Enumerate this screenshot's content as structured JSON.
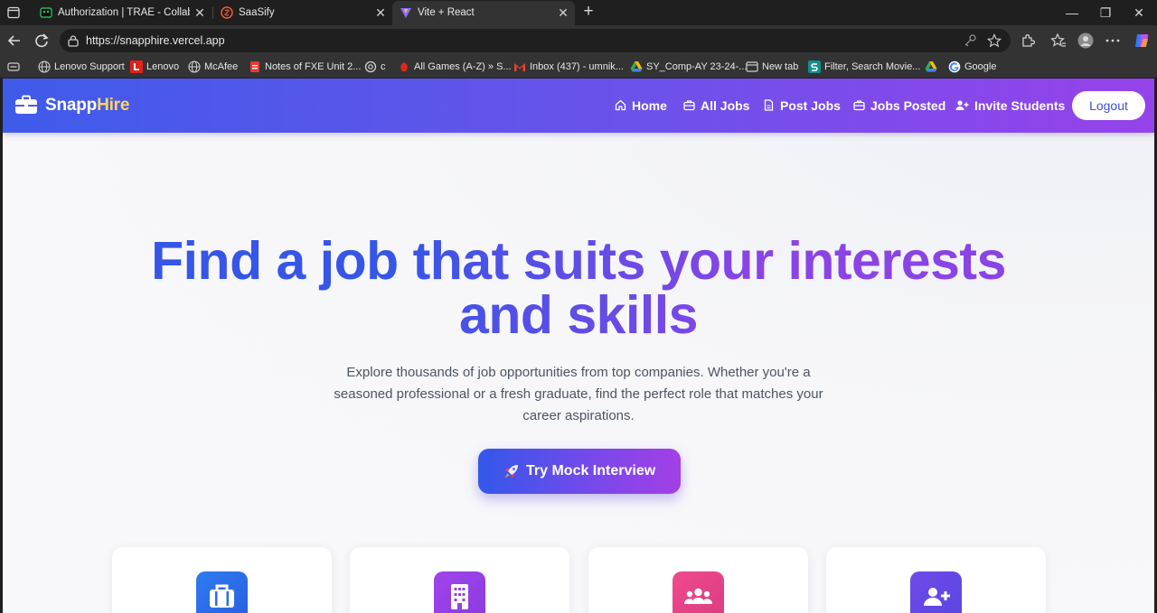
{
  "browser": {
    "tabs": [
      {
        "title": "Authorization | TRAE - Collaborat",
        "favicon": "trae-icon",
        "active": false
      },
      {
        "title": "SaaSify",
        "favicon": "saasify-icon",
        "active": false
      },
      {
        "title": "Vite + React",
        "favicon": "vite-icon",
        "active": true
      }
    ],
    "close_glyph": "✕",
    "new_tab_glyph": "+",
    "window_controls": [
      "—",
      "❐",
      "✕"
    ],
    "address": "https://snapphire.vercel.app",
    "bookmarks": [
      {
        "label": "Lenovo Support",
        "icon": "globe-icon"
      },
      {
        "label": "Lenovo",
        "icon": "lenovo-icon"
      },
      {
        "label": "McAfee",
        "icon": "globe-icon"
      },
      {
        "label": "Notes of FXE Unit 2...",
        "icon": "pdf-icon"
      },
      {
        "label": "c",
        "icon": "chatgpt-icon"
      },
      {
        "label": "All Games (A-Z) » S...",
        "icon": "game-icon"
      },
      {
        "label": "Inbox (437) - umnik...",
        "icon": "gmail-icon"
      },
      {
        "label": "SY_Comp-AY 23-24-...",
        "icon": "drive-icon"
      },
      {
        "label": "New tab",
        "icon": "newtab-icon"
      },
      {
        "label": "Filter, Search Movie...",
        "icon": "s-icon"
      },
      {
        "label": "",
        "icon": "drive-icon"
      },
      {
        "label": "Google",
        "icon": "google-icon"
      }
    ]
  },
  "navbar": {
    "brand_main": "Snapp",
    "brand_highlight": "Hire",
    "items": [
      {
        "label": "Home",
        "icon": "home-icon"
      },
      {
        "label": "All Jobs",
        "icon": "briefcase-icon"
      },
      {
        "label": "Post Jobs",
        "icon": "document-icon"
      },
      {
        "label": "Jobs Posted",
        "icon": "briefcase-icon"
      },
      {
        "label": "Invite Students",
        "icon": "user-plus-icon"
      }
    ],
    "logout_label": "Logout"
  },
  "hero": {
    "title": "Find a job that suits your interests and skills",
    "subtitle": "Explore thousands of job opportunities from top companies. Whether you're a seasoned professional or a fresh graduate, find the perfect role that matches your career aspirations.",
    "cta_label": "Try Mock Interview",
    "cta_icon": "rocket-icon"
  },
  "cards": [
    {
      "icon": "briefcase-icon",
      "color": "#2f6fea"
    },
    {
      "icon": "building-icon",
      "color": "#9b3fe6"
    },
    {
      "icon": "users-icon",
      "color": "#e8428f"
    },
    {
      "icon": "user-plus-icon",
      "color": "#6a48e6"
    }
  ],
  "colors": {
    "navbar_start": "#3f5bea",
    "navbar_end": "#9642ea",
    "brand_highlight": "#fdd65c",
    "logout_text": "#3f4ed3"
  }
}
